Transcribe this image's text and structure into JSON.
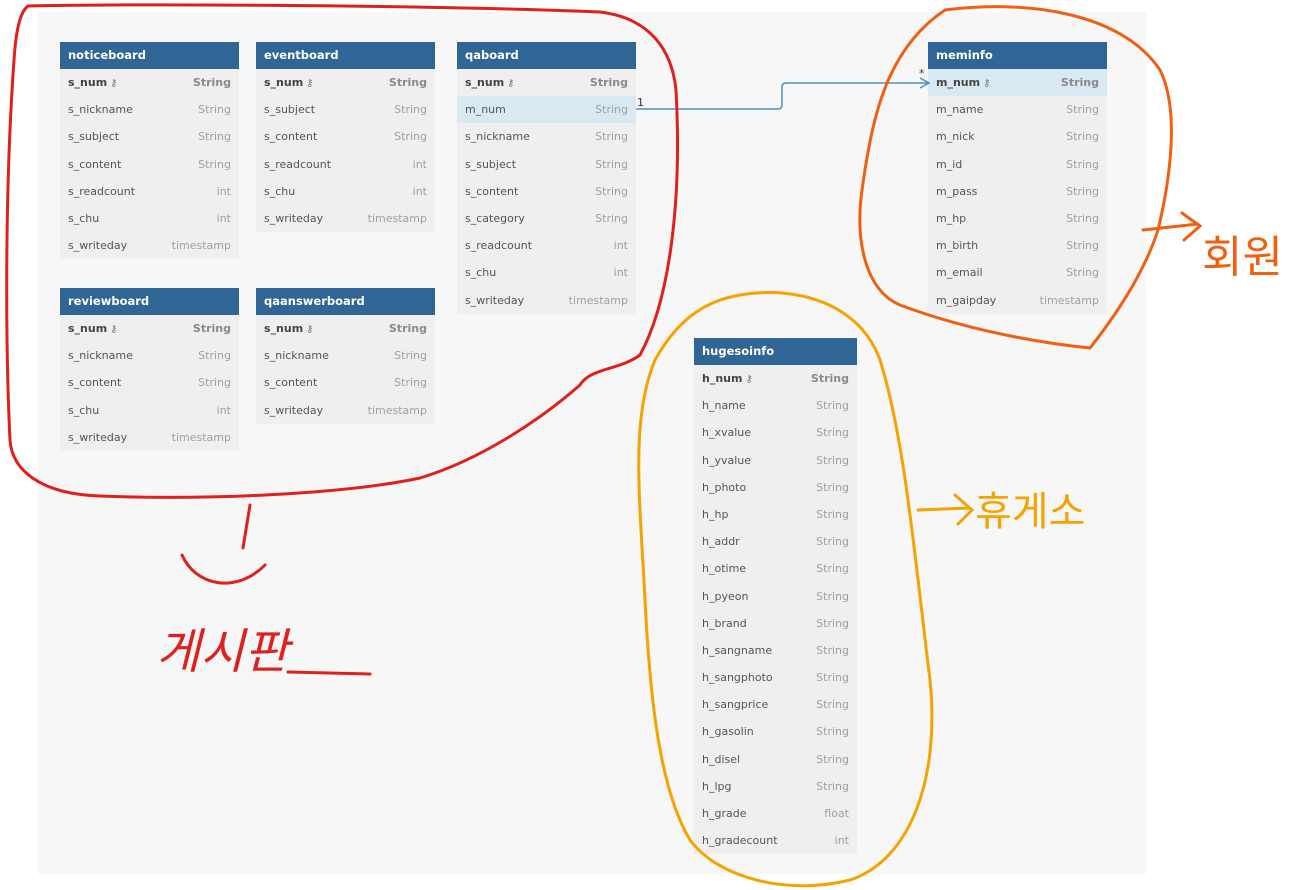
{
  "tables": [
    {
      "id": "noticeboard",
      "title": "noticeboard",
      "cols": [
        {
          "name": "s_num",
          "type": "String",
          "pk": true
        },
        {
          "name": "s_nickname",
          "type": "String"
        },
        {
          "name": "s_subject",
          "type": "String"
        },
        {
          "name": "s_content",
          "type": "String"
        },
        {
          "name": "s_readcount",
          "type": "int"
        },
        {
          "name": "s_chu",
          "type": "int"
        },
        {
          "name": "s_writeday",
          "type": "timestamp"
        }
      ]
    },
    {
      "id": "eventboard",
      "title": "eventboard",
      "cols": [
        {
          "name": "s_num",
          "type": "String",
          "pk": true
        },
        {
          "name": "s_subject",
          "type": "String"
        },
        {
          "name": "s_content",
          "type": "String"
        },
        {
          "name": "s_readcount",
          "type": "int"
        },
        {
          "name": "s_chu",
          "type": "int"
        },
        {
          "name": "s_writeday",
          "type": "timestamp"
        }
      ]
    },
    {
      "id": "qaboard",
      "title": "qaboard",
      "cols": [
        {
          "name": "s_num",
          "type": "String",
          "pk": true
        },
        {
          "name": "m_num",
          "type": "String",
          "hl": true
        },
        {
          "name": "s_nickname",
          "type": "String"
        },
        {
          "name": "s_subject",
          "type": "String"
        },
        {
          "name": "s_content",
          "type": "String"
        },
        {
          "name": "s_category",
          "type": "String"
        },
        {
          "name": "s_readcount",
          "type": "int"
        },
        {
          "name": "s_chu",
          "type": "int"
        },
        {
          "name": "s_writeday",
          "type": "timestamp"
        }
      ]
    },
    {
      "id": "meminfo",
      "title": "meminfo",
      "cols": [
        {
          "name": "m_num",
          "type": "String",
          "pk": true,
          "hl": true
        },
        {
          "name": "m_name",
          "type": "String"
        },
        {
          "name": "m_nick",
          "type": "String"
        },
        {
          "name": "m_id",
          "type": "String"
        },
        {
          "name": "m_pass",
          "type": "String"
        },
        {
          "name": "m_hp",
          "type": "String"
        },
        {
          "name": "m_birth",
          "type": "String"
        },
        {
          "name": "m_email",
          "type": "String"
        },
        {
          "name": "m_gaipday",
          "type": "timestamp"
        }
      ]
    },
    {
      "id": "reviewboard",
      "title": "reviewboard",
      "cols": [
        {
          "name": "s_num",
          "type": "String",
          "pk": true
        },
        {
          "name": "s_nickname",
          "type": "String"
        },
        {
          "name": "s_content",
          "type": "String"
        },
        {
          "name": "s_chu",
          "type": "int"
        },
        {
          "name": "s_writeday",
          "type": "timestamp"
        }
      ]
    },
    {
      "id": "qaanswerboard",
      "title": "qaanswerboard",
      "cols": [
        {
          "name": "s_num",
          "type": "String",
          "pk": true
        },
        {
          "name": "s_nickname",
          "type": "String"
        },
        {
          "name": "s_content",
          "type": "String"
        },
        {
          "name": "s_writeday",
          "type": "timestamp"
        }
      ]
    },
    {
      "id": "hugesoinfo",
      "title": "hugesoinfo",
      "cols": [
        {
          "name": "h_num",
          "type": "String",
          "pk": true
        },
        {
          "name": "h_name",
          "type": "String"
        },
        {
          "name": "h_xvalue",
          "type": "String"
        },
        {
          "name": "h_yvalue",
          "type": "String"
        },
        {
          "name": "h_photo",
          "type": "String"
        },
        {
          "name": "h_hp",
          "type": "String"
        },
        {
          "name": "h_addr",
          "type": "String"
        },
        {
          "name": "h_otime",
          "type": "String"
        },
        {
          "name": "h_pyeon",
          "type": "String"
        },
        {
          "name": "h_brand",
          "type": "String"
        },
        {
          "name": "h_sangname",
          "type": "String"
        },
        {
          "name": "h_sangphoto",
          "type": "String"
        },
        {
          "name": "h_sangprice",
          "type": "String"
        },
        {
          "name": "h_gasolin",
          "type": "String"
        },
        {
          "name": "h_disel",
          "type": "String"
        },
        {
          "name": "h_lpg",
          "type": "String"
        },
        {
          "name": "h_grade",
          "type": "float"
        },
        {
          "name": "h_gradecount",
          "type": "int"
        }
      ]
    }
  ],
  "relation": {
    "from": "qaboard.m_num",
    "to": "meminfo.m_num",
    "from_card": "1",
    "to_card": "*"
  },
  "annotations": {
    "board_label": "게시판",
    "member_label": "회원",
    "restarea_label": "휴게소",
    "board_color": "#e0201c",
    "member_color": "#f06010",
    "restarea_color": "#f5a300"
  },
  "colors": {
    "header": "#2f6696",
    "highlight": "#d9e9f2",
    "relation_line": "#4a90c8"
  }
}
